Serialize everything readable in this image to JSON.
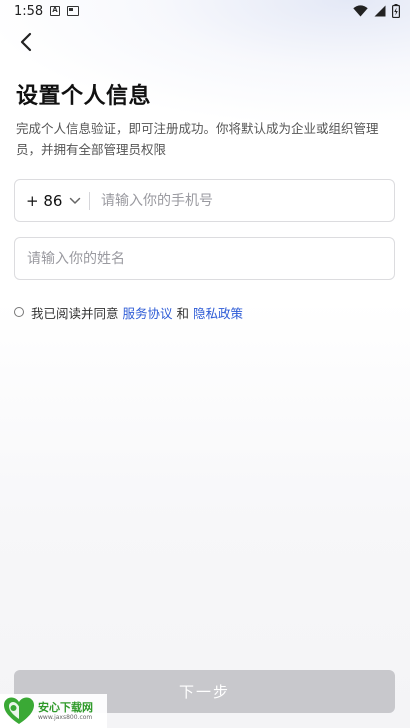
{
  "status_bar": {
    "time": "1:58",
    "app_icon_letter": "A"
  },
  "header": {
    "title": "设置个人信息",
    "description": "完成个人信息验证，即可注册成功。你将默认成为企业或组织管理员，并拥有全部管理员权限"
  },
  "form": {
    "country_code": "+ 86",
    "phone_placeholder": "请输入你的手机号",
    "phone_value": "",
    "name_placeholder": "请输入你的姓名",
    "name_value": ""
  },
  "agreement": {
    "prefix": "我已阅读并同意",
    "service_link": "服务协议",
    "conjunction": "和",
    "privacy_link": "隐私政策",
    "checked": false
  },
  "footer": {
    "next_label": "下一步"
  },
  "watermark": {
    "name": "安心下载网",
    "site": "www.jaxs800.com"
  },
  "colors": {
    "link": "#2d5bd6",
    "button_disabled": "#c8c8cc",
    "watermark_green": "#2f9a2a"
  },
  "icons": {
    "back": "chevron-left-icon",
    "dropdown": "chevron-down-icon",
    "wifi": "wifi-icon",
    "signal": "signal-icon",
    "battery": "battery-icon"
  }
}
